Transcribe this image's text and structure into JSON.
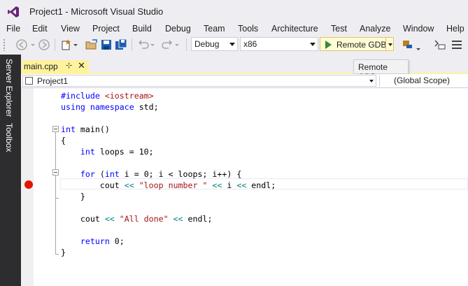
{
  "window": {
    "title": "Project1 - Microsoft Visual Studio"
  },
  "menu": [
    "File",
    "Edit",
    "View",
    "Project",
    "Build",
    "Debug",
    "Team",
    "Tools",
    "Architecture",
    "Test",
    "Analyze",
    "Window",
    "Help"
  ],
  "toolbar": {
    "configuration": "Debug",
    "platform": "x86",
    "run_label": "Remote GDB",
    "tooltip": "Remote GDB"
  },
  "sidebar": {
    "tabs": [
      "Server Explorer",
      "Toolbox"
    ]
  },
  "tabs": [
    {
      "label": "main.cpp",
      "pin": "⊹",
      "close": "✕"
    }
  ],
  "navbar": {
    "project": "Project1",
    "scope": "(Global Scope)"
  },
  "code_lines": [
    "#include <iostream>",
    "using namespace std;",
    "",
    "int main()",
    "{",
    "    int loops = 10;",
    "",
    "    for (int i = 0; i < loops; i++) {",
    "        cout << \"loop number \" << i << endl;",
    "    }",
    "",
    "    cout << \"All done\" << endl;",
    "",
    "    return 0;",
    "}"
  ],
  "colors": {
    "keyword": "#0000ff",
    "string": "#a31515",
    "operator": "#008080",
    "preprocessor": "#808080",
    "breakpoint": "#e51400",
    "tab_accent": "#fff29d"
  },
  "icons": [
    "vs-logo-icon",
    "back-icon",
    "forward-icon",
    "new-project-icon",
    "open-folder-icon",
    "save-icon",
    "save-all-icon",
    "undo-icon",
    "redo-icon",
    "play-icon",
    "find-icon",
    "solution-explorer-icon",
    "breakpoint-icon"
  ]
}
